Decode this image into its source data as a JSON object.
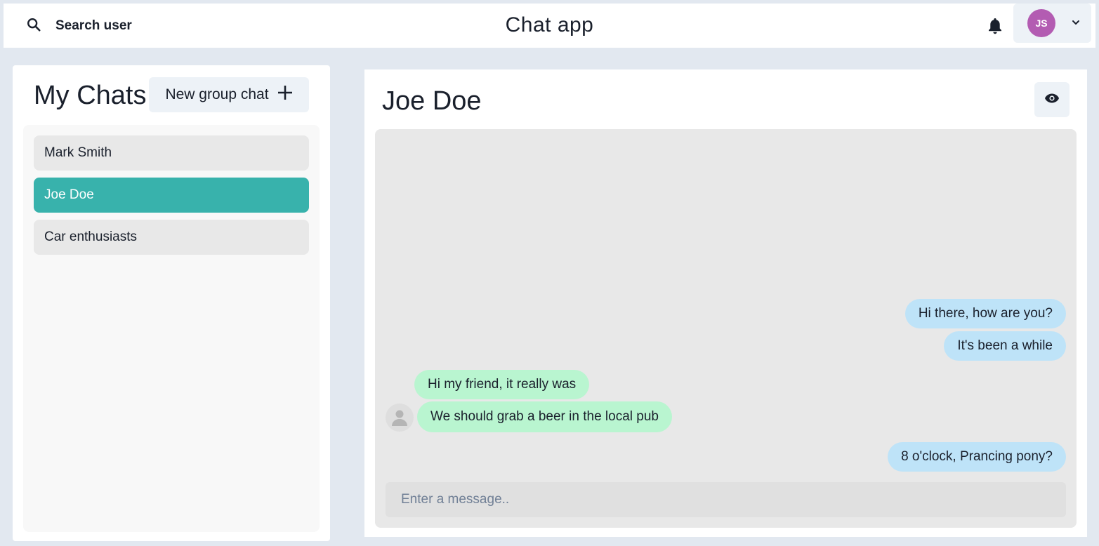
{
  "header": {
    "search_label": "Search user",
    "app_title": "Chat app",
    "user_initials": "JS",
    "icons": {
      "search": "search-icon",
      "notifications": "bell-icon",
      "dropdown": "chevron-down-icon"
    }
  },
  "sidebar": {
    "title": "My Chats",
    "new_group_label": "New group chat",
    "new_group_icon": "plus-icon",
    "chats": [
      {
        "name": "Mark Smith",
        "active": false
      },
      {
        "name": "Joe Doe",
        "active": true
      },
      {
        "name": "Car enthusiasts",
        "active": false
      }
    ]
  },
  "chat": {
    "title": "Joe Doe",
    "view_profile_icon": "eye-icon",
    "messages": [
      {
        "text": "Hi there, how are you?",
        "sender": "me"
      },
      {
        "text": "It's been a while",
        "sender": "me"
      },
      {
        "text": "Hi my friend, it really was",
        "sender": "Joe Doe"
      },
      {
        "text": "We should grab a beer in the local pub",
        "sender": "Joe Doe"
      },
      {
        "text": "8 o'clock, Prancing pony?",
        "sender": "me"
      }
    ],
    "input": {
      "value": "",
      "placeholder": "Enter a message.."
    }
  },
  "colors": {
    "accent": "#38b2ac",
    "avatar": "#b35cb2",
    "my_bubble": "#bee3f8",
    "their_bubble": "#b9f5d0"
  }
}
